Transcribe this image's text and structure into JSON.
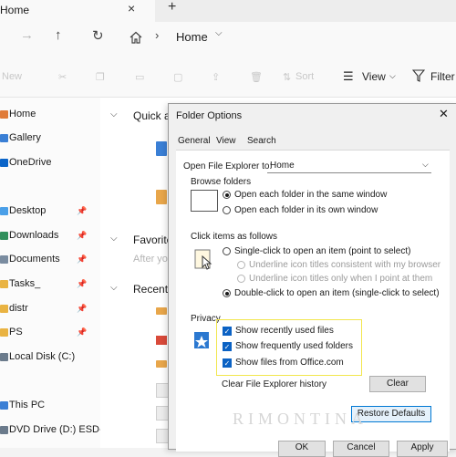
{
  "explorer": {
    "tab_title": "Home",
    "tab_close": "×",
    "tab_new": "+",
    "address": "Home",
    "commands": {
      "new": "New",
      "sort": "Sort",
      "view": "View",
      "filter": "Filter"
    },
    "sidebar": {
      "items": [
        {
          "label": "Home",
          "icon": "home-icon",
          "color": "#e07b39"
        },
        {
          "label": "Gallery",
          "icon": "gallery-icon",
          "color": "#3a7fd5"
        },
        {
          "label": "OneDrive",
          "icon": "cloud-icon",
          "color": "#0a64c8"
        },
        {
          "label": "Desktop",
          "icon": "desktop-icon",
          "color": "#4a9fe8"
        },
        {
          "label": "Downloads",
          "icon": "download-icon",
          "color": "#2f8f5b"
        },
        {
          "label": "Documents",
          "icon": "document-icon",
          "color": "#7a8ca0"
        },
        {
          "label": "Tasks_",
          "icon": "folder-icon",
          "color": "#e9b342"
        },
        {
          "label": "distr",
          "icon": "folder-icon",
          "color": "#e9b342"
        },
        {
          "label": "PS",
          "icon": "folder-icon",
          "color": "#e9b342"
        },
        {
          "label": "Local Disk (C:)",
          "icon": "drive-icon",
          "color": "#6b7b8c"
        },
        {
          "label": "This PC",
          "icon": "computer-icon",
          "color": "#3a7fd5"
        },
        {
          "label": "DVD Drive (D:) ESD-",
          "icon": "dvd-icon",
          "color": "#6b7b8c"
        }
      ]
    },
    "sections": {
      "quick_access": "Quick ac",
      "favorites": "Favorite",
      "favorites_hint": "After yo",
      "recent": "Recent"
    }
  },
  "dialog": {
    "title": "Folder Options",
    "close": "✕",
    "tabs": [
      "General",
      "View",
      "Search"
    ],
    "open_label": "Open File Explorer to:",
    "open_value": "Home",
    "browse_title": "Browse folders",
    "browse_options": [
      "Open each folder in the same window",
      "Open each folder in its own window"
    ],
    "browse_selected": 0,
    "click_title": "Click items as follows",
    "click_options": [
      "Single-click to open an item (point to select)",
      "Underline icon titles consistent with my browser",
      "Underline icon titles only when I point at them",
      "Double-click to open an item (single-click to select)"
    ],
    "click_selected": 3,
    "privacy_title": "Privacy",
    "privacy_options": [
      "Show recently used files",
      "Show frequently used folders",
      "Show files from Office.com"
    ],
    "clear_label": "Clear File Explorer history",
    "clear_button": "Clear",
    "restore_button": "Restore Defaults",
    "ok_button": "OK",
    "cancel_button": "Cancel",
    "apply_button": "Apply",
    "accent": "#0b62c4",
    "highlight": "#f2e64d"
  },
  "watermark": "RIMONTINA"
}
